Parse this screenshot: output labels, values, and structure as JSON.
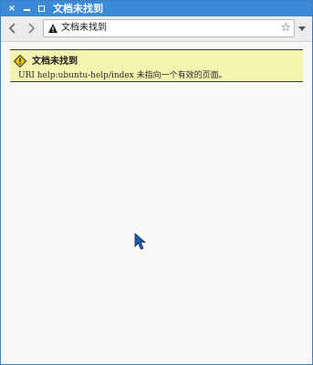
{
  "window": {
    "title": "文档未找到"
  },
  "titlebar": {
    "close_symbol": "×"
  },
  "toolbar": {
    "back_symbol": "‹",
    "forward_symbol": "›",
    "url_text": "文档未找到",
    "star_symbol": "☆"
  },
  "notice": {
    "title": "文档未找到",
    "message": "URI help:ubuntu-help/index 未指向一个有效的页面。",
    "background_color": "#f5f3b0"
  },
  "colors": {
    "titlebar": "#3a8ad8",
    "window_border": "#3c7fc4"
  },
  "icons": {
    "close": "close-icon",
    "minimize": "minimize-icon",
    "maximize": "maximize-icon",
    "back": "back-arrow-icon",
    "forward": "forward-arrow-icon",
    "url_warning": "warning-triangle-icon",
    "bookmark": "star-icon",
    "url_menu": "chevron-down-icon",
    "notice_warning": "warning-diamond-icon",
    "cursor": "mouse-pointer-icon"
  }
}
